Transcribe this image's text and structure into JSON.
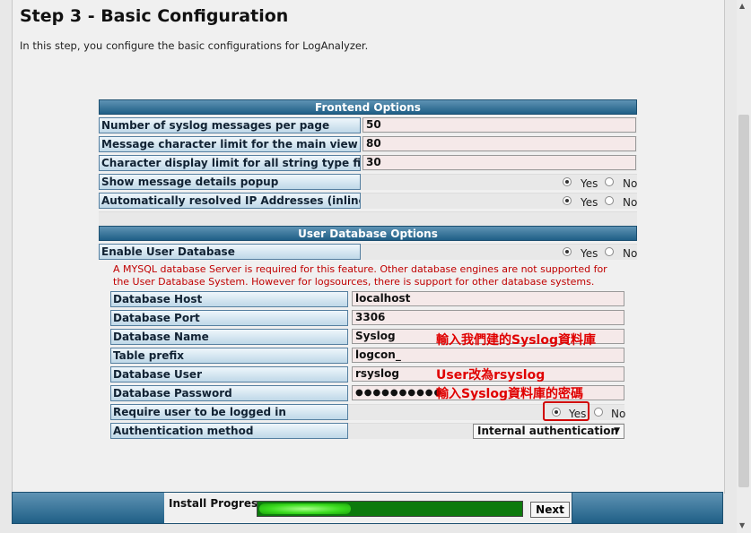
{
  "page": {
    "title": "Step 3 - Basic Configuration",
    "subtitle": "In this step, you configure the basic configurations for LogAnalyzer."
  },
  "frontend": {
    "header": "Frontend Options",
    "rows": [
      {
        "label": "Number of syslog messages per page",
        "value": "50"
      },
      {
        "label": "Message character limit for the main view",
        "value": "80"
      },
      {
        "label": "Character display limit for all string type fields",
        "value": "30"
      },
      {
        "label": "Show message details popup",
        "selected": "Yes"
      },
      {
        "label": "Automatically resolved IP Addresses (inline)",
        "selected": "Yes"
      }
    ]
  },
  "radio": {
    "yes": "Yes",
    "no": "No"
  },
  "userdb": {
    "header": "User Database Options",
    "enable_label": "Enable User Database",
    "enable_selected": "Yes",
    "warning": "A MYSQL database Server is required for this feature. Other database engines are not supported for the User Database System. However for logsources, there is support for other database systems.",
    "rows": [
      {
        "label": "Database Host",
        "value": "localhost"
      },
      {
        "label": "Database Port",
        "value": "3306"
      },
      {
        "label": "Database Name",
        "value": "Syslog"
      },
      {
        "label": "Table prefix",
        "value": "logcon_"
      },
      {
        "label": "Database User",
        "value": "rsyslog"
      },
      {
        "label": "Database Password",
        "value": "●●●●●●●●●●"
      }
    ],
    "require_label": "Require user to be logged in",
    "require_selected": "Yes",
    "auth_label": "Authentication method",
    "auth_value": "Internal authentication"
  },
  "annotations": {
    "dbname": "輸入我們建的Syslog資料庫",
    "dbuser": "User改為rsyslog",
    "dbpass": "輸入Syslog資料庫的密碼"
  },
  "footer": {
    "progress_label": "Install Progress:",
    "progress_fraction": 0.35,
    "next_label": "Next"
  },
  "colors": {
    "accent": "#1f5f86",
    "warning": "#c00000",
    "annotation": "#e00000",
    "progress": "#3bdc1f"
  }
}
